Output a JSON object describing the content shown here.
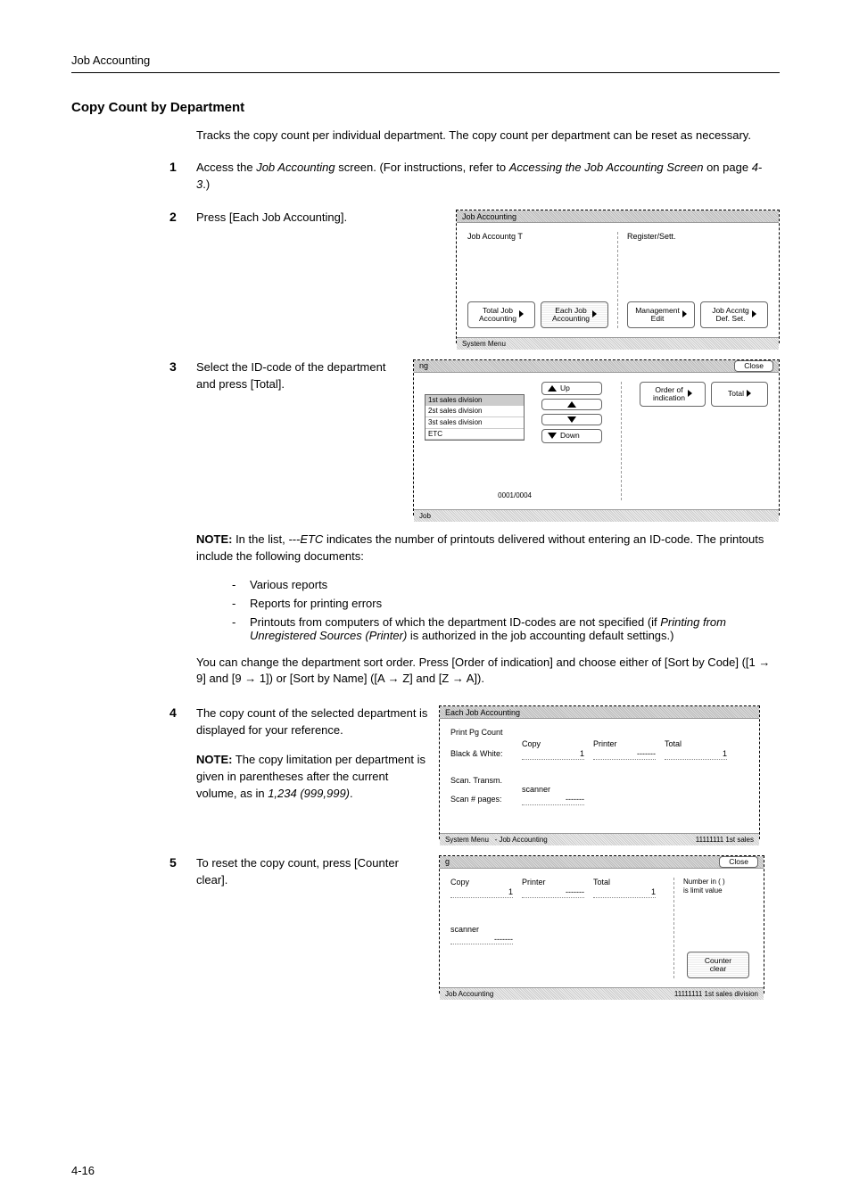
{
  "header": {
    "running": "Job Accounting"
  },
  "title": "Copy Count by Department",
  "intro": "Tracks the copy count per individual department. The copy count per department can be reset as necessary.",
  "steps": {
    "s1a": "Access the ",
    "s1b": "Job Accounting",
    "s1c": " screen. (For instructions, refer to ",
    "s1d": "Accessing the Job Accounting Screen",
    "s1e": " on page ",
    "s1f": "4-3",
    "s1g": ".)",
    "s2": "Press [Each Job Accounting].",
    "s3": "Select the ID-code of the department and press [Total].",
    "s4": "The copy count of the selected department is displayed for your reference.",
    "s4note_a": "NOTE:",
    "s4note_b": " The copy limitation per department is given in parentheses after the current volume, as in ",
    "s4note_c": "1,234 (999,999)",
    "s4note_d": ".",
    "s5": "To reset the copy count, press [Counter clear]."
  },
  "note_head": "NOTE:",
  "note_body_a": " In the list, ",
  "note_body_b": "---ETC",
  "note_body_c": " indicates the number of printouts delivered without entering an ID-code. The printouts include the following documents:",
  "bullets": {
    "b1": "Various reports",
    "b2": "Reports for printing errors",
    "b3a": "Printouts from computers of which the department ID-codes are not specified (if ",
    "b3b": "Printing from Unregistered Sources (Printer)",
    "b3c": " is authorized in the job accounting default settings.)"
  },
  "sort_a": "You can change the department sort order. Press [Order of indication] and choose either of [Sort by Code] ([1 ",
  "sort_b": " 9] and [9 ",
  "sort_c": " 1]) or [Sort by Name] ([A ",
  "sort_d": " Z] and [Z ",
  "sort_e": " A]).",
  "arrow": "→",
  "panel1": {
    "title": "Job Accounting",
    "left_label": "Job Accountg T",
    "right_label": "Register/Sett.",
    "btn_total": "Total Job\nAccounting",
    "btn_each": "Each Job\nAccounting",
    "btn_mgmt": "Management\nEdit",
    "btn_def": "Job Accntg\nDef. Set.",
    "footer": "System Menu"
  },
  "panel2": {
    "title_frag": "ng",
    "close": "Close",
    "items": [
      "1st sales division",
      "2st sales division",
      "3st sales division",
      "ETC"
    ],
    "up": "Up",
    "down": "Down",
    "order": "Order of\nindication",
    "total": "Total",
    "count": "0001/0004",
    "footer": "Job"
  },
  "panel3": {
    "title": "Each Job Accounting",
    "row1": "Print Pg Count",
    "col_copy": "Copy",
    "col_printer": "Printer",
    "col_total": "Total",
    "bw": "Black & White:",
    "v1": "1",
    "vdash": "-------",
    "scan_t": "Scan. Transm.",
    "scanner": "scanner",
    "scan_n": "Scan # pages:",
    "footer_l": "System Menu",
    "footer_m": "- Job Accounting",
    "footer_r": "11111111  1st sales"
  },
  "panel4": {
    "title_frag": "g",
    "close": "Close",
    "copy": "Copy",
    "printer": "Printer",
    "total": "Total",
    "v1": "1",
    "vdash": "-------",
    "legend": "Number in ( )\nis limit value",
    "scanner": "scanner",
    "counter": "Counter\nclear",
    "footer_l": "Job Accounting",
    "footer_r": "11111111  1st sales division"
  },
  "page_num": "4-16"
}
